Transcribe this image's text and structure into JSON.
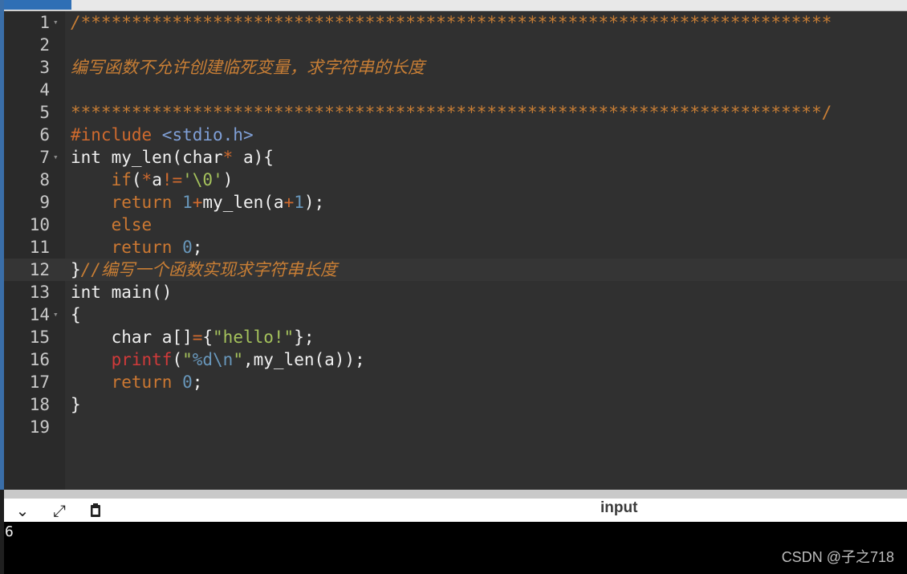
{
  "editor": {
    "lines": [
      {
        "n": "1",
        "fold": "▾",
        "segs": [
          [
            "c-com",
            "/**************************************************************************"
          ]
        ]
      },
      {
        "n": "2",
        "fold": "",
        "segs": []
      },
      {
        "n": "3",
        "fold": "",
        "segs": [
          [
            "c-com",
            "编写函数不允许创建临死变量，求字符串的长度"
          ]
        ]
      },
      {
        "n": "4",
        "fold": "",
        "segs": []
      },
      {
        "n": "5",
        "fold": "",
        "segs": [
          [
            "c-star",
            "**************************************************************************/"
          ]
        ]
      },
      {
        "n": "6",
        "fold": "",
        "segs": [
          [
            "c-pre",
            "#include "
          ],
          [
            "c-inc",
            "<stdio.h>"
          ]
        ]
      },
      {
        "n": "7",
        "fold": "▾",
        "segs": [
          [
            "",
            "int my_len(char"
          ],
          [
            "c-op",
            "*"
          ],
          [
            "",
            " a){"
          ]
        ]
      },
      {
        "n": "8",
        "fold": "",
        "segs": [
          [
            "",
            "    "
          ],
          [
            "c-kw",
            "if"
          ],
          [
            "",
            "("
          ],
          [
            "c-op",
            "*"
          ],
          [
            "",
            "a"
          ],
          [
            "c-op",
            "!="
          ],
          [
            "c-str",
            "'\\0'"
          ],
          [
            "",
            ")"
          ]
        ]
      },
      {
        "n": "9",
        "fold": "",
        "segs": [
          [
            "",
            "    "
          ],
          [
            "c-kw",
            "return "
          ],
          [
            "c-num",
            "1"
          ],
          [
            "c-op",
            "+"
          ],
          [
            "",
            "my_len(a"
          ],
          [
            "c-op",
            "+"
          ],
          [
            "c-num",
            "1"
          ],
          [
            "",
            ");"
          ]
        ]
      },
      {
        "n": "10",
        "fold": "",
        "segs": [
          [
            "",
            "    "
          ],
          [
            "c-kw",
            "else"
          ]
        ]
      },
      {
        "n": "11",
        "fold": "",
        "segs": [
          [
            "",
            "    "
          ],
          [
            "c-kw",
            "return "
          ],
          [
            "c-num",
            "0"
          ],
          [
            "",
            ";"
          ]
        ]
      },
      {
        "n": "12",
        "fold": "",
        "active": true,
        "segs": [
          [
            "",
            "}"
          ],
          [
            "c-com",
            "//编写一个函数实现求字符串长度"
          ]
        ]
      },
      {
        "n": "13",
        "fold": "",
        "segs": [
          [
            "",
            "int main()"
          ]
        ]
      },
      {
        "n": "14",
        "fold": "▾",
        "segs": [
          [
            "",
            "{"
          ]
        ]
      },
      {
        "n": "15",
        "fold": "",
        "segs": [
          [
            "",
            "    char a[]"
          ],
          [
            "c-op",
            "="
          ],
          [
            "",
            "{"
          ],
          [
            "c-str",
            "\"hello!\""
          ],
          [
            "",
            "};"
          ]
        ]
      },
      {
        "n": "16",
        "fold": "",
        "segs": [
          [
            "",
            "    "
          ],
          [
            "c-fn",
            "printf"
          ],
          [
            "",
            "("
          ],
          [
            "c-str",
            "\""
          ],
          [
            "c-num",
            "%d\\n"
          ],
          [
            "c-str",
            "\""
          ],
          [
            "",
            ",my_len(a));"
          ]
        ]
      },
      {
        "n": "17",
        "fold": "",
        "segs": [
          [
            "",
            "    "
          ],
          [
            "c-kw",
            "return "
          ],
          [
            "c-num",
            "0"
          ],
          [
            "",
            ";"
          ]
        ]
      },
      {
        "n": "18",
        "fold": "",
        "segs": [
          [
            "",
            "}"
          ]
        ]
      },
      {
        "n": "19",
        "fold": "",
        "segs": []
      }
    ]
  },
  "panel": {
    "label": "input",
    "icons": {
      "collapse": "chevron-down-icon",
      "expand": "expand-arrows-icon",
      "clear": "clipboard-icon"
    },
    "output": "6"
  },
  "watermark": "CSDN @子之718"
}
